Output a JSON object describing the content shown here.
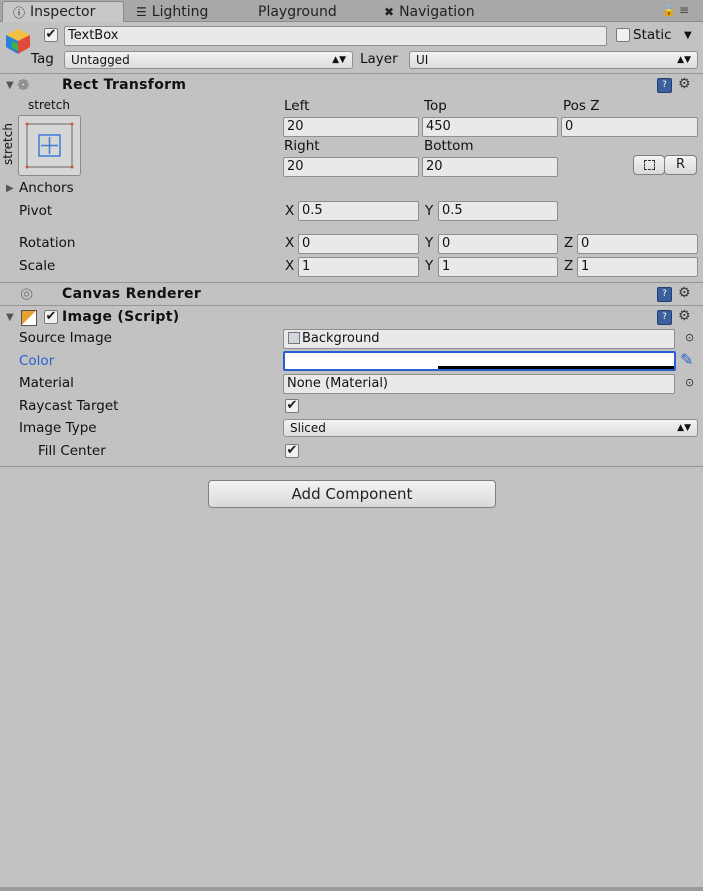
{
  "tabs": [
    {
      "label": "Inspector",
      "icon": "info-icon"
    },
    {
      "label": "Lighting",
      "icon": "lighting-icon"
    },
    {
      "label": "Playground",
      "icon": ""
    },
    {
      "label": "Navigation",
      "icon": "navigation-icon"
    }
  ],
  "object": {
    "name": "TextBox",
    "static_label": "Static",
    "tag_label": "Tag",
    "tag_value": "Untagged",
    "layer_label": "Layer",
    "layer_value": "UI"
  },
  "rect_transform": {
    "title": "Rect Transform",
    "anchor_top_label": "stretch",
    "anchor_side_label": "stretch",
    "left_label": "Left",
    "left_value": "20",
    "top_label": "Top",
    "top_value": "450",
    "posz_label": "Pos Z",
    "posz_value": "0",
    "right_label": "Right",
    "right_value": "20",
    "bottom_label": "Bottom",
    "bottom_value": "20",
    "r_button": "R",
    "anchors_label": "Anchors",
    "pivot_label": "Pivot",
    "pivot_x": "0.5",
    "pivot_y": "0.5",
    "rotation_label": "Rotation",
    "rotation_x": "0",
    "rotation_y": "0",
    "rotation_z": "0",
    "scale_label": "Scale",
    "scale_x": "1",
    "scale_y": "1",
    "scale_z": "1",
    "axis_x": "X",
    "axis_y": "Y",
    "axis_z": "Z"
  },
  "canvas_renderer": {
    "title": "Canvas Renderer"
  },
  "image": {
    "title": "Image (Script)",
    "source_image_label": "Source Image",
    "source_image_value": "Background",
    "color_label": "Color",
    "material_label": "Material",
    "material_value": "None (Material)",
    "raycast_label": "Raycast Target",
    "image_type_label": "Image Type",
    "image_type_value": "Sliced",
    "fill_center_label": "Fill Center"
  },
  "add_component": "Add Component",
  "colors": {
    "accent_blue": "#2a5fd0",
    "panel_bg": "#c2c2c2"
  }
}
